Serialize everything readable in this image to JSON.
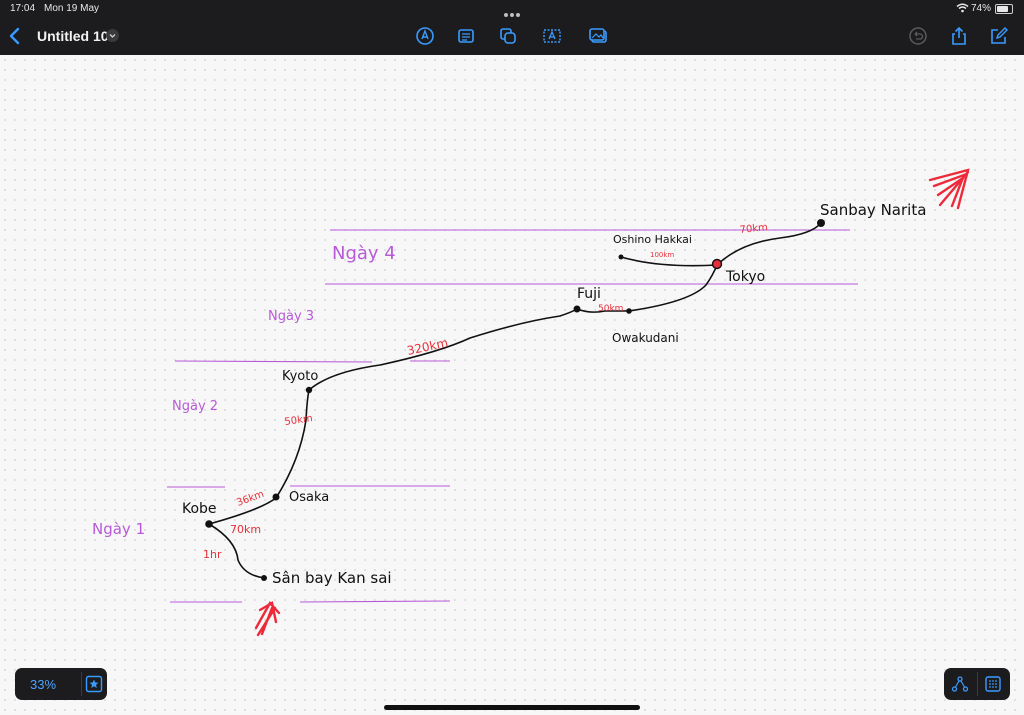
{
  "status_bar": {
    "time": "17:04",
    "date": "Mon 19 May",
    "battery": "74%"
  },
  "toolbar": {
    "title": "Untitled 10",
    "tools": [
      "pen-tool-icon",
      "text-block-icon",
      "shapes-icon",
      "text-box-icon",
      "media-icon"
    ],
    "right_icons": [
      "undo-icon",
      "share-icon",
      "edit-icon"
    ]
  },
  "board": {
    "zoom": "33%",
    "days": {
      "day1": "Ngày 1",
      "day2": "Ngày 2",
      "day3": "Ngày 3",
      "day4": "Ngày 4"
    },
    "places": {
      "kobe": "Kobe",
      "osaka": "Osaka",
      "kansai": "Sân bay Kan sai",
      "kyoto": "Kyoto",
      "fuji": "Fuji",
      "owakudani": "Owakudani",
      "tokyo": "Tokyo",
      "oshino": "Oshino Hakkai",
      "narita": "Sanbay Narita"
    },
    "distances": {
      "kobe_osaka": "36km",
      "kobe_kansai_km": "70km",
      "kobe_kansai_time": "1hr",
      "osaka_kyoto": "50km",
      "kyoto_fuji": "320km",
      "fuji_owakudani": "50km",
      "oshino_tokyo": "100km",
      "tokyo_narita": "70km"
    },
    "colors": {
      "day_labels": "#b85ad8",
      "distance_text": "#e8303a",
      "route_line": "#111111",
      "arrow": "#ee2a3a"
    }
  }
}
